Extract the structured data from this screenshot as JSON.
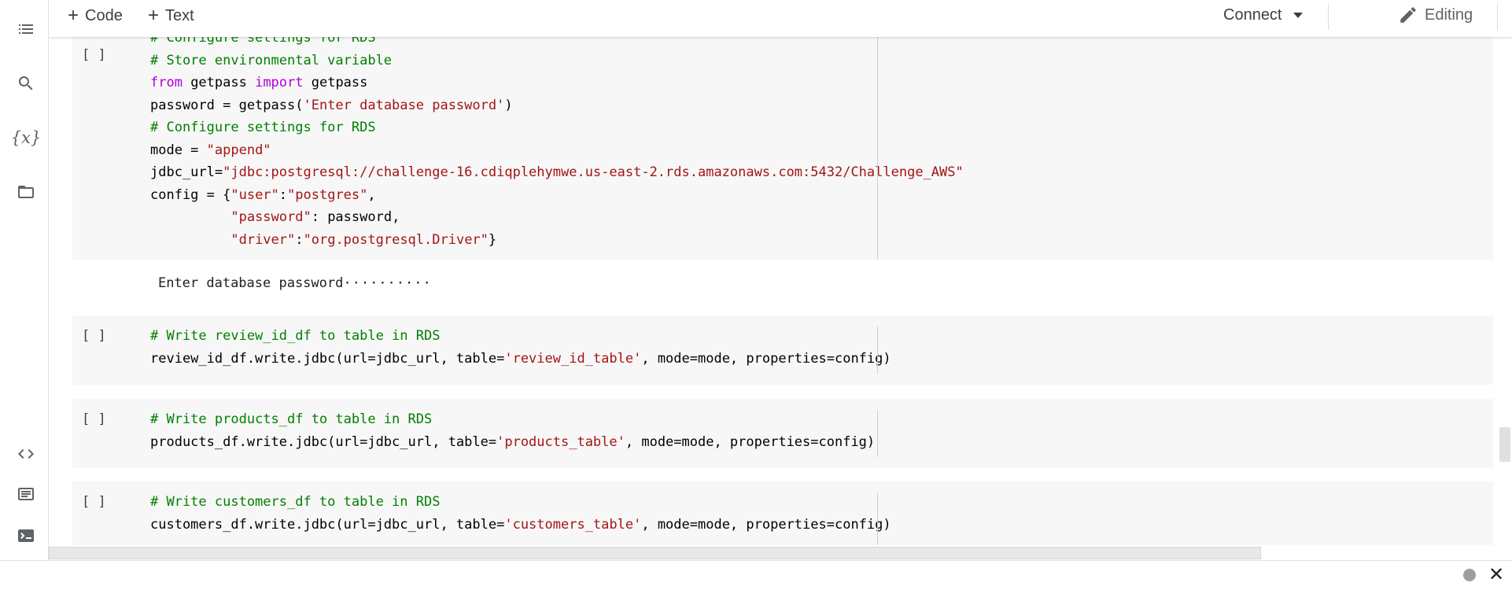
{
  "toolbar": {
    "add_code_label": "Code",
    "add_text_label": "Text",
    "connect_label": "Connect",
    "editing_label": "Editing"
  },
  "sidebar": {
    "icons": [
      "table-of-contents-icon",
      "search-icon",
      "variables-icon",
      "files-icon",
      "code-snippets-icon",
      "command-palette-icon",
      "terminal-icon"
    ],
    "variables_glyph": "{x}"
  },
  "cells": [
    {
      "run_label": "[ ]",
      "lines": [
        [
          {
            "t": "# Configure settings for RDS",
            "k": "comment"
          }
        ],
        [
          {
            "t": "# Store environmental variable",
            "k": "comment"
          }
        ],
        [
          {
            "t": "from",
            "k": "kw"
          },
          {
            "t": " getpass ",
            "k": "plain"
          },
          {
            "t": "import",
            "k": "kw"
          },
          {
            "t": " getpass",
            "k": "plain"
          }
        ],
        [
          {
            "t": "password = getpass(",
            "k": "plain"
          },
          {
            "t": "'Enter database password'",
            "k": "str"
          },
          {
            "t": ")",
            "k": "plain"
          }
        ],
        [
          {
            "t": "# Configure settings for RDS",
            "k": "comment"
          }
        ],
        [
          {
            "t": "mode = ",
            "k": "plain"
          },
          {
            "t": "\"append\"",
            "k": "str"
          }
        ],
        [
          {
            "t": "jdbc_url=",
            "k": "plain"
          },
          {
            "t": "\"jdbc:postgresql://challenge-16.cdiqplehymwe.us-east-2.rds.amazonaws.com:5432/Challenge_AWS\"",
            "k": "str"
          }
        ],
        [
          {
            "t": "config = {",
            "k": "plain"
          },
          {
            "t": "\"user\"",
            "k": "str"
          },
          {
            "t": ":",
            "k": "plain"
          },
          {
            "t": "\"postgres\"",
            "k": "str"
          },
          {
            "t": ",",
            "k": "plain"
          }
        ],
        [
          {
            "t": "          ",
            "k": "plain"
          },
          {
            "t": "\"password\"",
            "k": "str"
          },
          {
            "t": ": password,",
            "k": "plain"
          }
        ],
        [
          {
            "t": "          ",
            "k": "plain"
          },
          {
            "t": "\"driver\"",
            "k": "str"
          },
          {
            "t": ":",
            "k": "plain"
          },
          {
            "t": "\"org.postgresql.Driver\"",
            "k": "str"
          },
          {
            "t": "}",
            "k": "plain"
          }
        ]
      ],
      "output_prompt": "Enter database password",
      "output_masked": "··········"
    },
    {
      "run_label": "[ ]",
      "lines": [
        [
          {
            "t": "# Write review_id_df to table in RDS",
            "k": "comment"
          }
        ],
        [
          {
            "t": "review_id_df.write.jdbc(url=jdbc_url, table=",
            "k": "plain"
          },
          {
            "t": "'review_id_table'",
            "k": "str"
          },
          {
            "t": ", mode=mode, properties=config)",
            "k": "plain"
          }
        ]
      ]
    },
    {
      "run_label": "[ ]",
      "lines": [
        [
          {
            "t": "# Write products_df to table in RDS",
            "k": "comment"
          }
        ],
        [
          {
            "t": "products_df.write.jdbc(url=jdbc_url, table=",
            "k": "plain"
          },
          {
            "t": "'products_table'",
            "k": "str"
          },
          {
            "t": ", mode=mode, properties=config)",
            "k": "plain"
          }
        ]
      ]
    },
    {
      "run_label": "[ ]",
      "lines": [
        [
          {
            "t": "# Write customers_df to table in RDS",
            "k": "comment"
          }
        ],
        [
          {
            "t": "customers_df.write.jdbc(url=jdbc_url, table=",
            "k": "plain"
          },
          {
            "t": "'customers_table'",
            "k": "str"
          },
          {
            "t": ", mode=mode, properties=config)",
            "k": "plain"
          }
        ]
      ]
    }
  ],
  "colors": {
    "comment": "#008000",
    "keyword": "#af00db",
    "string": "#a31515",
    "cell_background": "#f7f7f7"
  }
}
